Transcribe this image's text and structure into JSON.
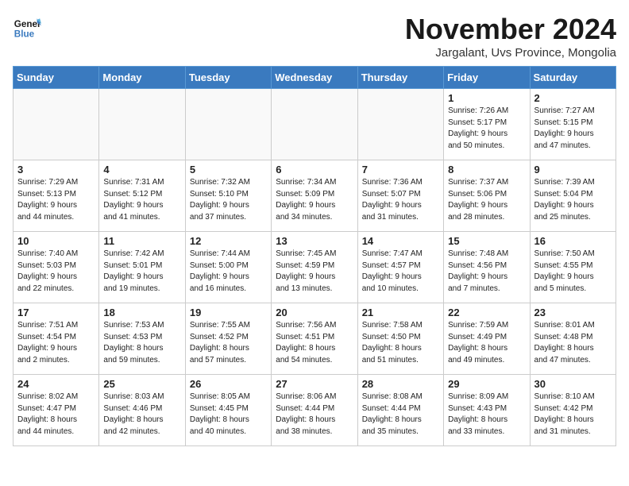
{
  "header": {
    "logo_line1": "General",
    "logo_line2": "Blue",
    "month": "November 2024",
    "location": "Jargalant, Uvs Province, Mongolia"
  },
  "weekdays": [
    "Sunday",
    "Monday",
    "Tuesday",
    "Wednesday",
    "Thursday",
    "Friday",
    "Saturday"
  ],
  "weeks": [
    [
      {
        "day": "",
        "info": ""
      },
      {
        "day": "",
        "info": ""
      },
      {
        "day": "",
        "info": ""
      },
      {
        "day": "",
        "info": ""
      },
      {
        "day": "",
        "info": ""
      },
      {
        "day": "1",
        "info": "Sunrise: 7:26 AM\nSunset: 5:17 PM\nDaylight: 9 hours\nand 50 minutes."
      },
      {
        "day": "2",
        "info": "Sunrise: 7:27 AM\nSunset: 5:15 PM\nDaylight: 9 hours\nand 47 minutes."
      }
    ],
    [
      {
        "day": "3",
        "info": "Sunrise: 7:29 AM\nSunset: 5:13 PM\nDaylight: 9 hours\nand 44 minutes."
      },
      {
        "day": "4",
        "info": "Sunrise: 7:31 AM\nSunset: 5:12 PM\nDaylight: 9 hours\nand 41 minutes."
      },
      {
        "day": "5",
        "info": "Sunrise: 7:32 AM\nSunset: 5:10 PM\nDaylight: 9 hours\nand 37 minutes."
      },
      {
        "day": "6",
        "info": "Sunrise: 7:34 AM\nSunset: 5:09 PM\nDaylight: 9 hours\nand 34 minutes."
      },
      {
        "day": "7",
        "info": "Sunrise: 7:36 AM\nSunset: 5:07 PM\nDaylight: 9 hours\nand 31 minutes."
      },
      {
        "day": "8",
        "info": "Sunrise: 7:37 AM\nSunset: 5:06 PM\nDaylight: 9 hours\nand 28 minutes."
      },
      {
        "day": "9",
        "info": "Sunrise: 7:39 AM\nSunset: 5:04 PM\nDaylight: 9 hours\nand 25 minutes."
      }
    ],
    [
      {
        "day": "10",
        "info": "Sunrise: 7:40 AM\nSunset: 5:03 PM\nDaylight: 9 hours\nand 22 minutes."
      },
      {
        "day": "11",
        "info": "Sunrise: 7:42 AM\nSunset: 5:01 PM\nDaylight: 9 hours\nand 19 minutes."
      },
      {
        "day": "12",
        "info": "Sunrise: 7:44 AM\nSunset: 5:00 PM\nDaylight: 9 hours\nand 16 minutes."
      },
      {
        "day": "13",
        "info": "Sunrise: 7:45 AM\nSunset: 4:59 PM\nDaylight: 9 hours\nand 13 minutes."
      },
      {
        "day": "14",
        "info": "Sunrise: 7:47 AM\nSunset: 4:57 PM\nDaylight: 9 hours\nand 10 minutes."
      },
      {
        "day": "15",
        "info": "Sunrise: 7:48 AM\nSunset: 4:56 PM\nDaylight: 9 hours\nand 7 minutes."
      },
      {
        "day": "16",
        "info": "Sunrise: 7:50 AM\nSunset: 4:55 PM\nDaylight: 9 hours\nand 5 minutes."
      }
    ],
    [
      {
        "day": "17",
        "info": "Sunrise: 7:51 AM\nSunset: 4:54 PM\nDaylight: 9 hours\nand 2 minutes."
      },
      {
        "day": "18",
        "info": "Sunrise: 7:53 AM\nSunset: 4:53 PM\nDaylight: 8 hours\nand 59 minutes."
      },
      {
        "day": "19",
        "info": "Sunrise: 7:55 AM\nSunset: 4:52 PM\nDaylight: 8 hours\nand 57 minutes."
      },
      {
        "day": "20",
        "info": "Sunrise: 7:56 AM\nSunset: 4:51 PM\nDaylight: 8 hours\nand 54 minutes."
      },
      {
        "day": "21",
        "info": "Sunrise: 7:58 AM\nSunset: 4:50 PM\nDaylight: 8 hours\nand 51 minutes."
      },
      {
        "day": "22",
        "info": "Sunrise: 7:59 AM\nSunset: 4:49 PM\nDaylight: 8 hours\nand 49 minutes."
      },
      {
        "day": "23",
        "info": "Sunrise: 8:01 AM\nSunset: 4:48 PM\nDaylight: 8 hours\nand 47 minutes."
      }
    ],
    [
      {
        "day": "24",
        "info": "Sunrise: 8:02 AM\nSunset: 4:47 PM\nDaylight: 8 hours\nand 44 minutes."
      },
      {
        "day": "25",
        "info": "Sunrise: 8:03 AM\nSunset: 4:46 PM\nDaylight: 8 hours\nand 42 minutes."
      },
      {
        "day": "26",
        "info": "Sunrise: 8:05 AM\nSunset: 4:45 PM\nDaylight: 8 hours\nand 40 minutes."
      },
      {
        "day": "27",
        "info": "Sunrise: 8:06 AM\nSunset: 4:44 PM\nDaylight: 8 hours\nand 38 minutes."
      },
      {
        "day": "28",
        "info": "Sunrise: 8:08 AM\nSunset: 4:44 PM\nDaylight: 8 hours\nand 35 minutes."
      },
      {
        "day": "29",
        "info": "Sunrise: 8:09 AM\nSunset: 4:43 PM\nDaylight: 8 hours\nand 33 minutes."
      },
      {
        "day": "30",
        "info": "Sunrise: 8:10 AM\nSunset: 4:42 PM\nDaylight: 8 hours\nand 31 minutes."
      }
    ]
  ]
}
